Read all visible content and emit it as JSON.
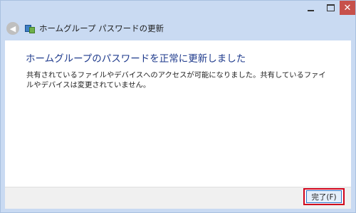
{
  "window": {
    "title": "ホームグループ パスワードの更新",
    "controls": {
      "minimize_icon": "minimize-icon",
      "maximize_icon": "maximize-icon",
      "close_icon": "close-icon",
      "close_glyph": "✕"
    },
    "back_glyph": "◀"
  },
  "content": {
    "heading": "ホームグループのパスワードを正常に更新しました",
    "message": "共有されているファイルやデバイスへのアクセスが可能になりました。共有しているファイルやデバイスは変更されていません。"
  },
  "footer": {
    "finish_label": "完了(F)"
  },
  "colors": {
    "heading": "#1e3a8c",
    "close_button": "#c7504b",
    "highlight": "#d0021b"
  }
}
